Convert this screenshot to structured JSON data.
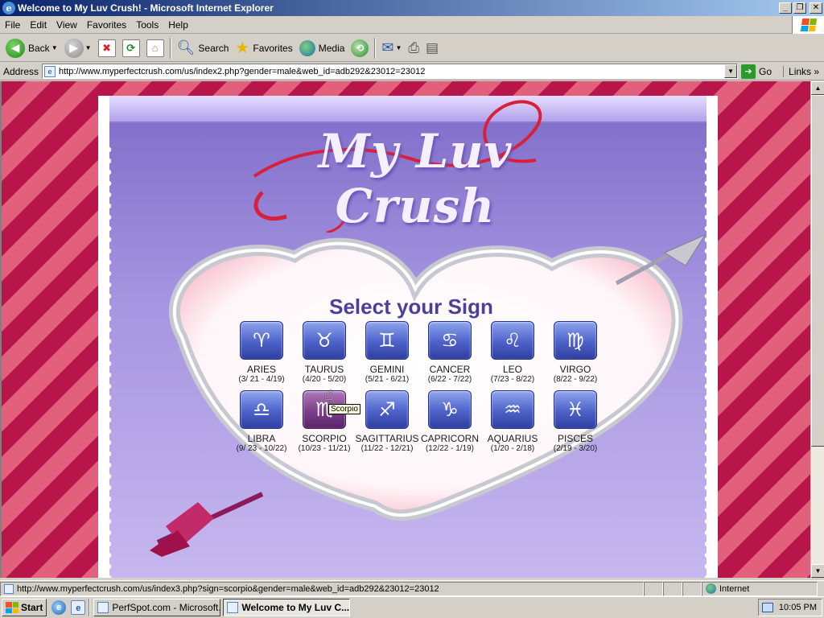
{
  "window": {
    "title": "Welcome to My Luv Crush! - Microsoft Internet Explorer",
    "minimize": "_",
    "restore": "❐",
    "close": "✕"
  },
  "menu": [
    "File",
    "Edit",
    "View",
    "Favorites",
    "Tools",
    "Help"
  ],
  "toolbar": {
    "back": "Back",
    "search": "Search",
    "favorites": "Favorites",
    "media": "Media"
  },
  "address": {
    "label": "Address",
    "url": "http://www.myperfectcrush.com/us/index2.php?gender=male&web_id=adb292&23012=23012",
    "go": "Go",
    "links": "Links"
  },
  "page": {
    "logo": "My Luv Crush",
    "heading": "Select your Sign",
    "tooltip": "Scorpio",
    "signs": [
      {
        "name": "ARIES",
        "dates": "(3/ 21 - 4/19)",
        "glyph": "♈",
        "icon": "aries-icon"
      },
      {
        "name": "TAURUS",
        "dates": "(4/20 - 5/20)",
        "glyph": "♉",
        "icon": "taurus-icon"
      },
      {
        "name": "GEMINI",
        "dates": "(5/21 - 6/21)",
        "glyph": "♊",
        "icon": "gemini-icon"
      },
      {
        "name": "CANCER",
        "dates": "(6/22 - 7/22)",
        "glyph": "♋",
        "icon": "cancer-icon"
      },
      {
        "name": "LEO",
        "dates": "(7/23 - 8/22)",
        "glyph": "♌",
        "icon": "leo-icon"
      },
      {
        "name": "VIRGO",
        "dates": "(8/22 - 9/22)",
        "glyph": "♍",
        "icon": "virgo-icon"
      },
      {
        "name": "LIBRA",
        "dates": "(9/ 23 - 10/22)",
        "glyph": "♎",
        "icon": "libra-icon"
      },
      {
        "name": "SCORPIO",
        "dates": "(10/23 - 11/21)",
        "glyph": "♏",
        "icon": "scorpio-icon"
      },
      {
        "name": "SAGITTARIUS",
        "dates": "(11/22 - 12/21)",
        "glyph": "♐",
        "icon": "sagittarius-icon"
      },
      {
        "name": "CAPRICORN",
        "dates": "(12/22 - 1/19)",
        "glyph": "♑",
        "icon": "capricorn-icon"
      },
      {
        "name": "AQUARIUS",
        "dates": "(1/20 - 2/18)",
        "glyph": "♒",
        "icon": "aquarius-icon"
      },
      {
        "name": "PISCES",
        "dates": "(2/19 - 3/20)",
        "glyph": "♓",
        "icon": "pisces-icon"
      }
    ]
  },
  "status": {
    "url": "http://www.myperfectcrush.com/us/index3.php?sign=scorpio&gender=male&web_id=adb292&23012=23012",
    "zone": "Internet"
  },
  "taskbar": {
    "start": "Start",
    "tasks": [
      "PerfSpot.com - Microsoft...",
      "Welcome to My Luv C..."
    ],
    "clock": "10:05 PM"
  },
  "colors": {
    "stripe_dark": "#b8164a",
    "stripe_light": "#e2607c",
    "heading": "#4b3f9a",
    "sign_button": "#4d62c8"
  }
}
